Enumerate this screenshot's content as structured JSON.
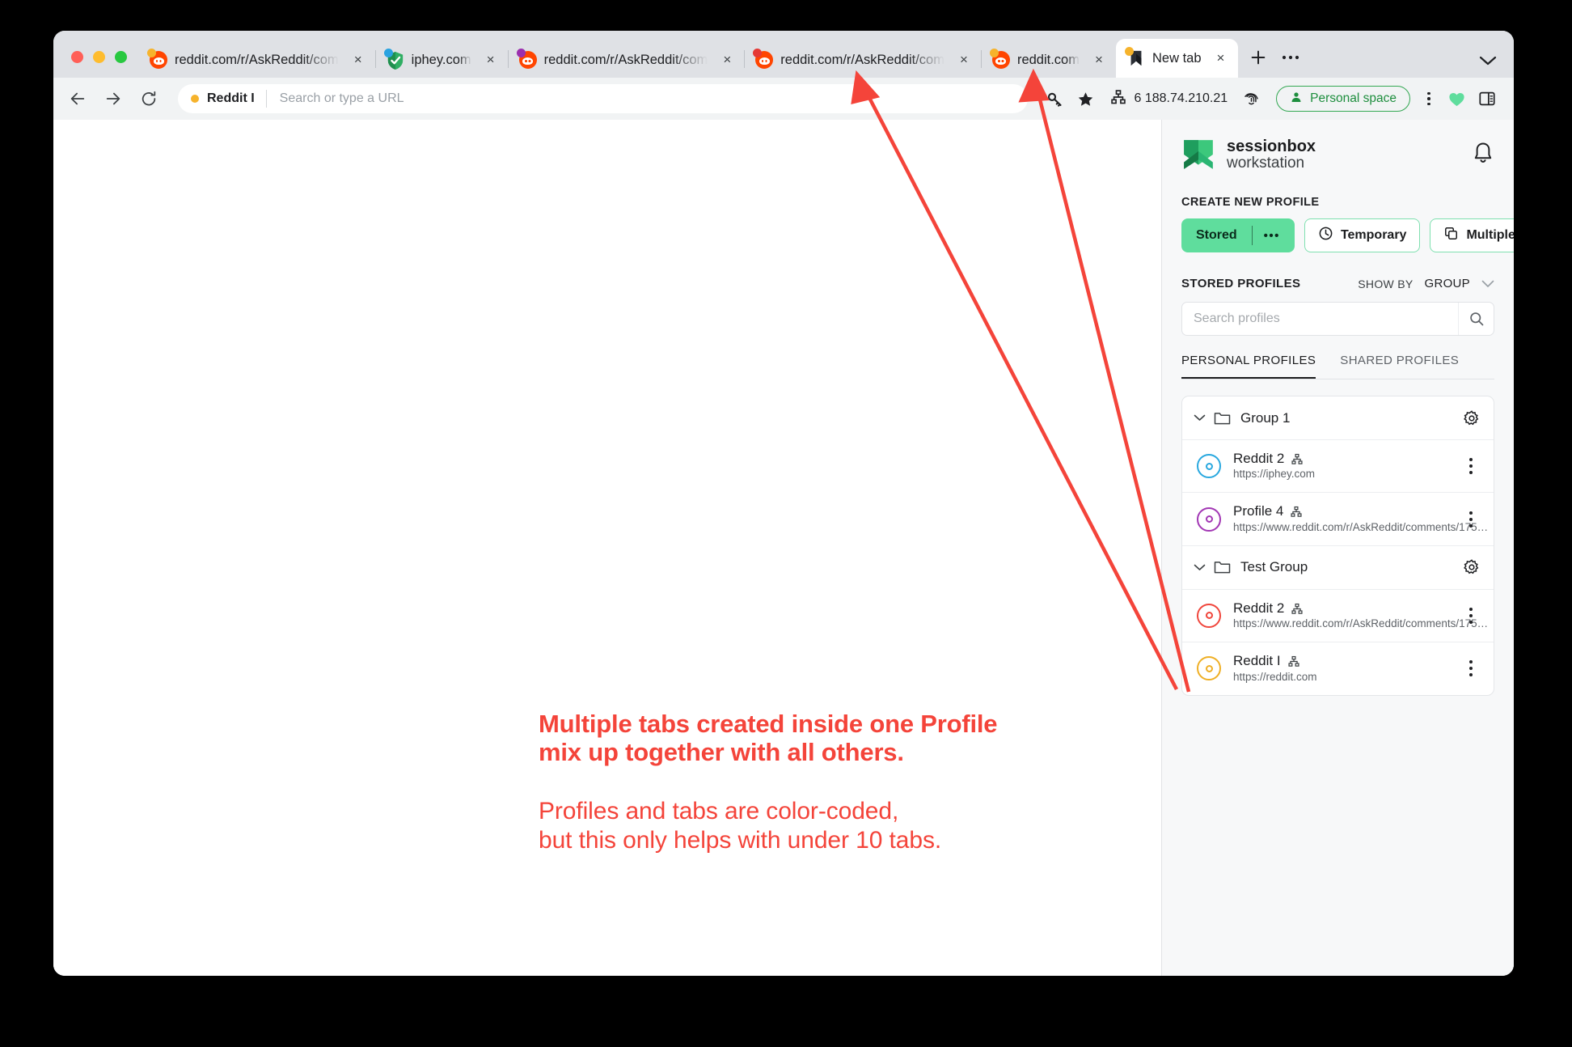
{
  "window": {
    "traffic_lights": [
      "close",
      "minimize",
      "zoom"
    ]
  },
  "tabstrip": {
    "tabs": [
      {
        "title": "reddit.com/r/AskReddit/com",
        "favicon": "reddit-icon",
        "badge_color": "#f6b32c",
        "active": false
      },
      {
        "title": "iphey.com",
        "favicon": "shield-check-icon",
        "badge_color": "#2aa3e0",
        "active": false
      },
      {
        "title": "reddit.com/r/AskReddit/com",
        "favicon": "reddit-icon",
        "badge_color": "#9b2fae",
        "active": false
      },
      {
        "title": "reddit.com/r/AskReddit/com",
        "favicon": "reddit-icon",
        "badge_color": "#e53935",
        "active": false
      },
      {
        "title": "reddit.com",
        "favicon": "reddit-icon",
        "badge_color": "#f6b32c",
        "active": false
      },
      {
        "title": "New tab",
        "favicon": "sessionbox-icon",
        "badge_color": "#f6b32c",
        "active": true
      }
    ],
    "close_glyph": "×",
    "new_tab_label": "+",
    "more_label": "…",
    "tab_list_label": "⌄"
  },
  "toolbar": {
    "back_label": "←",
    "forward_label": "→",
    "reload_label": "⟳",
    "omnibox": {
      "profile_name": "Reddit I",
      "profile_dot_color": "#f6b32c",
      "placeholder": "Search or type a URL",
      "value": ""
    },
    "password_icon": "key-icon",
    "bookmark_icon": "star-icon",
    "proxy": {
      "icon": "network-icon",
      "label": "6 188.74.210.21"
    },
    "fingerprint_icon": "fingerprint-icon",
    "space_chip": {
      "icon": "user-icon",
      "label": "Personal space",
      "color": "#1e8e3e"
    },
    "menu_icon": "kebab-icon",
    "heart_icon": "heart-icon",
    "sidebar_icon": "sidebar-panel-icon"
  },
  "page": {
    "annotation": {
      "bold_lines": [
        "Multiple tabs created inside one Profile",
        "mix up together with all others."
      ],
      "regular_lines": [
        "Profiles and tabs are color-coded,",
        "but this only helps with under 10 tabs."
      ],
      "color": "#f4443a"
    }
  },
  "panel": {
    "brand": {
      "line1": "sessionbox",
      "line2": "workstation",
      "logo_color": "#3cc87c"
    },
    "notification_icon": "bell-icon",
    "create_section_label": "CREATE NEW PROFILE",
    "create_buttons": {
      "stored": {
        "label": "Stored",
        "more": "•••",
        "bg": "#5fdd9d"
      },
      "temporary": {
        "label": "Temporary",
        "icon": "clock-icon"
      },
      "multiple": {
        "label": "Multiple",
        "icon": "copy-icon"
      }
    },
    "stored_profiles_label": "STORED PROFILES",
    "show_by": {
      "label": "SHOW BY",
      "value": "GROUP"
    },
    "search": {
      "placeholder": "Search profiles",
      "value": "",
      "icon": "search-icon"
    },
    "tabs": [
      {
        "label": "PERSONAL PROFILES",
        "active": true
      },
      {
        "label": "SHARED PROFILES",
        "active": false
      }
    ],
    "groups": [
      {
        "name": "Group 1",
        "expanded": true,
        "profiles": [
          {
            "name": "Reddit 2",
            "url": "https://iphey.com",
            "color": "#29a8df",
            "proxy_icon": "network-icon"
          },
          {
            "name": "Profile 4",
            "url": "https://www.reddit.com/r/AskReddit/comments/175…",
            "color": "#a237b4",
            "proxy_icon": "network-icon"
          }
        ]
      },
      {
        "name": "Test Group",
        "expanded": true,
        "profiles": [
          {
            "name": "Reddit 2",
            "url": "https://www.reddit.com/r/AskReddit/comments/175…",
            "color": "#f0463c",
            "proxy_icon": "network-icon"
          },
          {
            "name": "Reddit I",
            "url": "https://reddit.com",
            "color": "#efaf25",
            "proxy_icon": "network-icon"
          }
        ]
      }
    ],
    "row_menu_icon": "kebab-icon",
    "group_settings_icon": "gear-icon"
  }
}
